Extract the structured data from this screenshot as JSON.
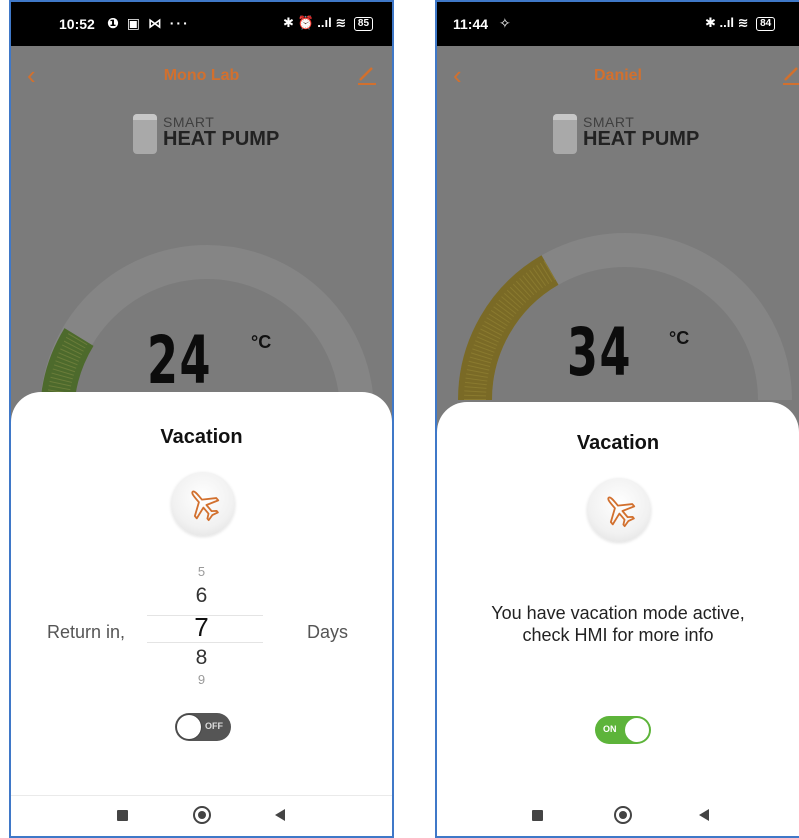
{
  "left": {
    "status": {
      "time": "10:52",
      "left_icons": "❶ ▣ ⋈ ···",
      "right_icons": "✱ ⏰ ..ıl ≋",
      "battery": "85"
    },
    "title": "Mono Lab",
    "logo": {
      "smart": "SMART",
      "heat_pump": "HEAT PUMP"
    },
    "temperature": {
      "value": "24",
      "unit": "°C",
      "gauge_fraction": 0.2
    },
    "vacation": {
      "title": "Vacation",
      "return_label": "Return in,",
      "days_label": "Days",
      "picker_values": [
        "5",
        "6",
        "7",
        "8",
        "9"
      ],
      "selected": "7",
      "toggle": {
        "state": "off",
        "label": "OFF"
      }
    }
  },
  "right": {
    "status": {
      "time": "11:44",
      "left_icons": "✧",
      "right_icons": "✱ ..ıl ≋",
      "battery": "84"
    },
    "title": "Daniel",
    "logo": {
      "smart": "SMART",
      "heat_pump": "HEAT PUMP"
    },
    "temperature": {
      "value": "34",
      "unit": "°C",
      "gauge_fraction": 0.3
    },
    "vacation": {
      "title": "Vacation",
      "message_line1": "You have vacation mode active,",
      "message_line2": "check HMI for more info",
      "toggle": {
        "state": "on",
        "label": "ON"
      }
    }
  },
  "colors": {
    "accent": "#d2702e",
    "toggle_on": "#5db43a",
    "toggle_off": "#555555",
    "frame": "#3f78c8",
    "overlay": "#7b7b7b"
  },
  "icons": {
    "back": "chevron-left-icon",
    "edit": "pencil-icon",
    "vacation": "airplane-icon",
    "nav_recent": "square-icon",
    "nav_home": "circle-icon",
    "nav_back": "triangle-back-icon"
  }
}
